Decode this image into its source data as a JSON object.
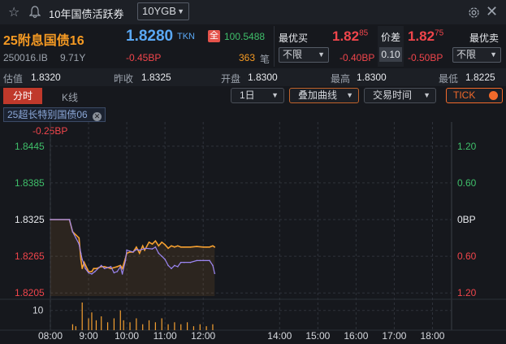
{
  "topbar": {
    "title": "10年国债活跃券",
    "selector": "10YGB"
  },
  "quote": {
    "name": "25附息国债16",
    "price": "1.8280",
    "tag": "TKN",
    "full_badge": "全",
    "full_price": "100.5488",
    "code": "250016.IB",
    "term": "9.71Y",
    "change": "-0.45BP",
    "volume": "363",
    "volume_unit": "笔"
  },
  "best_bid": {
    "label": "最优买",
    "price_main": "1.82",
    "price_sup": "85",
    "filter": "不限",
    "change": "-0.40BP"
  },
  "spread": {
    "label": "价差",
    "value": "0.10"
  },
  "best_ask": {
    "label": "最优卖",
    "price_main": "1.82",
    "price_sup": "75",
    "filter": "不限",
    "change": "-0.50BP"
  },
  "stats": {
    "est_label": "估值",
    "est_value": "1.8320",
    "prev_label": "昨收",
    "prev_value": "1.8325",
    "open_label": "开盘",
    "open_value": "1.8300",
    "high_label": "最高",
    "high_value": "1.8300",
    "low_label": "最低",
    "low_value": "1.8225"
  },
  "toolbar": {
    "tab_active": "分时",
    "tab_kline": "K线",
    "period": "1日",
    "overlay": "叠加曲线",
    "session": "交易时间",
    "tick": "TICK"
  },
  "overlay_chip": {
    "label": "25超长特别国债06"
  },
  "chart_data": {
    "type": "line",
    "overlay_change_label": "-0.25BP",
    "left_ticks": [
      "1.8445",
      "1.8385",
      "1.8325",
      "1.8265",
      "1.8205"
    ],
    "right_ticks": [
      "1.20",
      "0.60",
      "0BP",
      "0.60",
      "1.20"
    ],
    "volume_tick": "10",
    "x_ticks": [
      "08:00",
      "9:00",
      "10:00",
      "11:00",
      "12:00",
      "14:00",
      "15:00",
      "16:00",
      "17:00",
      "18:00"
    ],
    "series": [
      {
        "color": "#f5a030",
        "x": [
          "08:00",
          "08:30",
          "08:35",
          "08:40",
          "08:45",
          "08:48",
          "08:50",
          "08:53",
          "09:00",
          "09:05",
          "09:08",
          "09:12",
          "09:20",
          "09:25",
          "09:35",
          "09:45",
          "09:50",
          "09:53",
          "09:58",
          "10:00",
          "10:05",
          "10:10",
          "10:15",
          "10:20",
          "10:25",
          "10:28",
          "10:35",
          "10:40",
          "10:45",
          "10:50",
          "10:55",
          "11:00",
          "11:05",
          "11:10",
          "11:15",
          "11:20",
          "11:25",
          "11:30",
          "11:40",
          "11:50",
          "12:00",
          "12:05",
          "12:10",
          "12:15",
          "12:18"
        ],
        "y": [
          1.8325,
          1.8325,
          1.8305,
          1.83,
          1.8295,
          1.826,
          1.8245,
          1.8255,
          1.824,
          1.824,
          1.8245,
          1.8245,
          1.8248,
          1.8248,
          1.8245,
          1.8248,
          1.825,
          1.8245,
          1.8262,
          1.827,
          1.8272,
          1.8272,
          1.828,
          1.827,
          1.8282,
          1.8275,
          1.8288,
          1.8285,
          1.829,
          1.8282,
          1.8288,
          1.8284,
          1.8278,
          1.8282,
          1.828,
          1.8282,
          1.828,
          1.828,
          1.828,
          1.8281,
          1.828,
          1.828,
          1.828,
          1.8282,
          1.828
        ]
      },
      {
        "color": "#9b86f2",
        "x": [
          "08:00",
          "08:30",
          "08:35",
          "08:40",
          "08:45",
          "08:48",
          "08:50",
          "08:55",
          "09:00",
          "09:05",
          "09:10",
          "09:20",
          "09:25",
          "09:35",
          "09:40",
          "09:45",
          "09:50",
          "09:53",
          "09:58",
          "10:00",
          "10:10",
          "10:15",
          "10:20",
          "10:30",
          "10:40",
          "10:45",
          "10:50",
          "10:55",
          "11:00",
          "11:05",
          "11:10",
          "11:15",
          "11:20",
          "11:25",
          "11:30",
          "11:40",
          "11:50",
          "11:55",
          "12:00",
          "12:10",
          "12:15",
          "12:18"
        ],
        "y": [
          1.8325,
          1.8325,
          1.8305,
          1.8295,
          1.8285,
          1.827,
          1.826,
          1.8245,
          1.8238,
          1.8236,
          1.824,
          1.825,
          1.8245,
          1.8248,
          1.8238,
          1.824,
          1.8248,
          1.8236,
          1.8258,
          1.8275,
          1.8272,
          1.8276,
          1.8275,
          1.8278,
          1.8277,
          1.828,
          1.827,
          1.8265,
          1.826,
          1.825,
          1.8245,
          1.825,
          1.8248,
          1.8255,
          1.8255,
          1.8255,
          1.8258,
          1.8258,
          1.8258,
          1.8258,
          1.825,
          1.8237
        ]
      }
    ],
    "volume": {
      "x": [
        "08:35",
        "08:40",
        "08:50",
        "09:00",
        "09:05",
        "09:12",
        "09:20",
        "09:30",
        "09:40",
        "09:50",
        "09:55",
        "10:05",
        "10:15",
        "10:25",
        "10:35",
        "10:45",
        "10:55",
        "11:05",
        "11:15",
        "11:25",
        "11:35",
        "11:45",
        "11:55",
        "12:05",
        "12:15"
      ],
      "values": [
        3,
        2,
        14,
        6,
        9,
        5,
        7,
        4,
        6,
        10,
        5,
        4,
        6,
        3,
        5,
        4,
        6,
        3,
        4,
        3,
        4,
        2,
        3,
        2,
        3
      ]
    },
    "ylim": [
      1.82,
      1.845
    ],
    "xlim": [
      "08:00",
      "18:30"
    ]
  }
}
